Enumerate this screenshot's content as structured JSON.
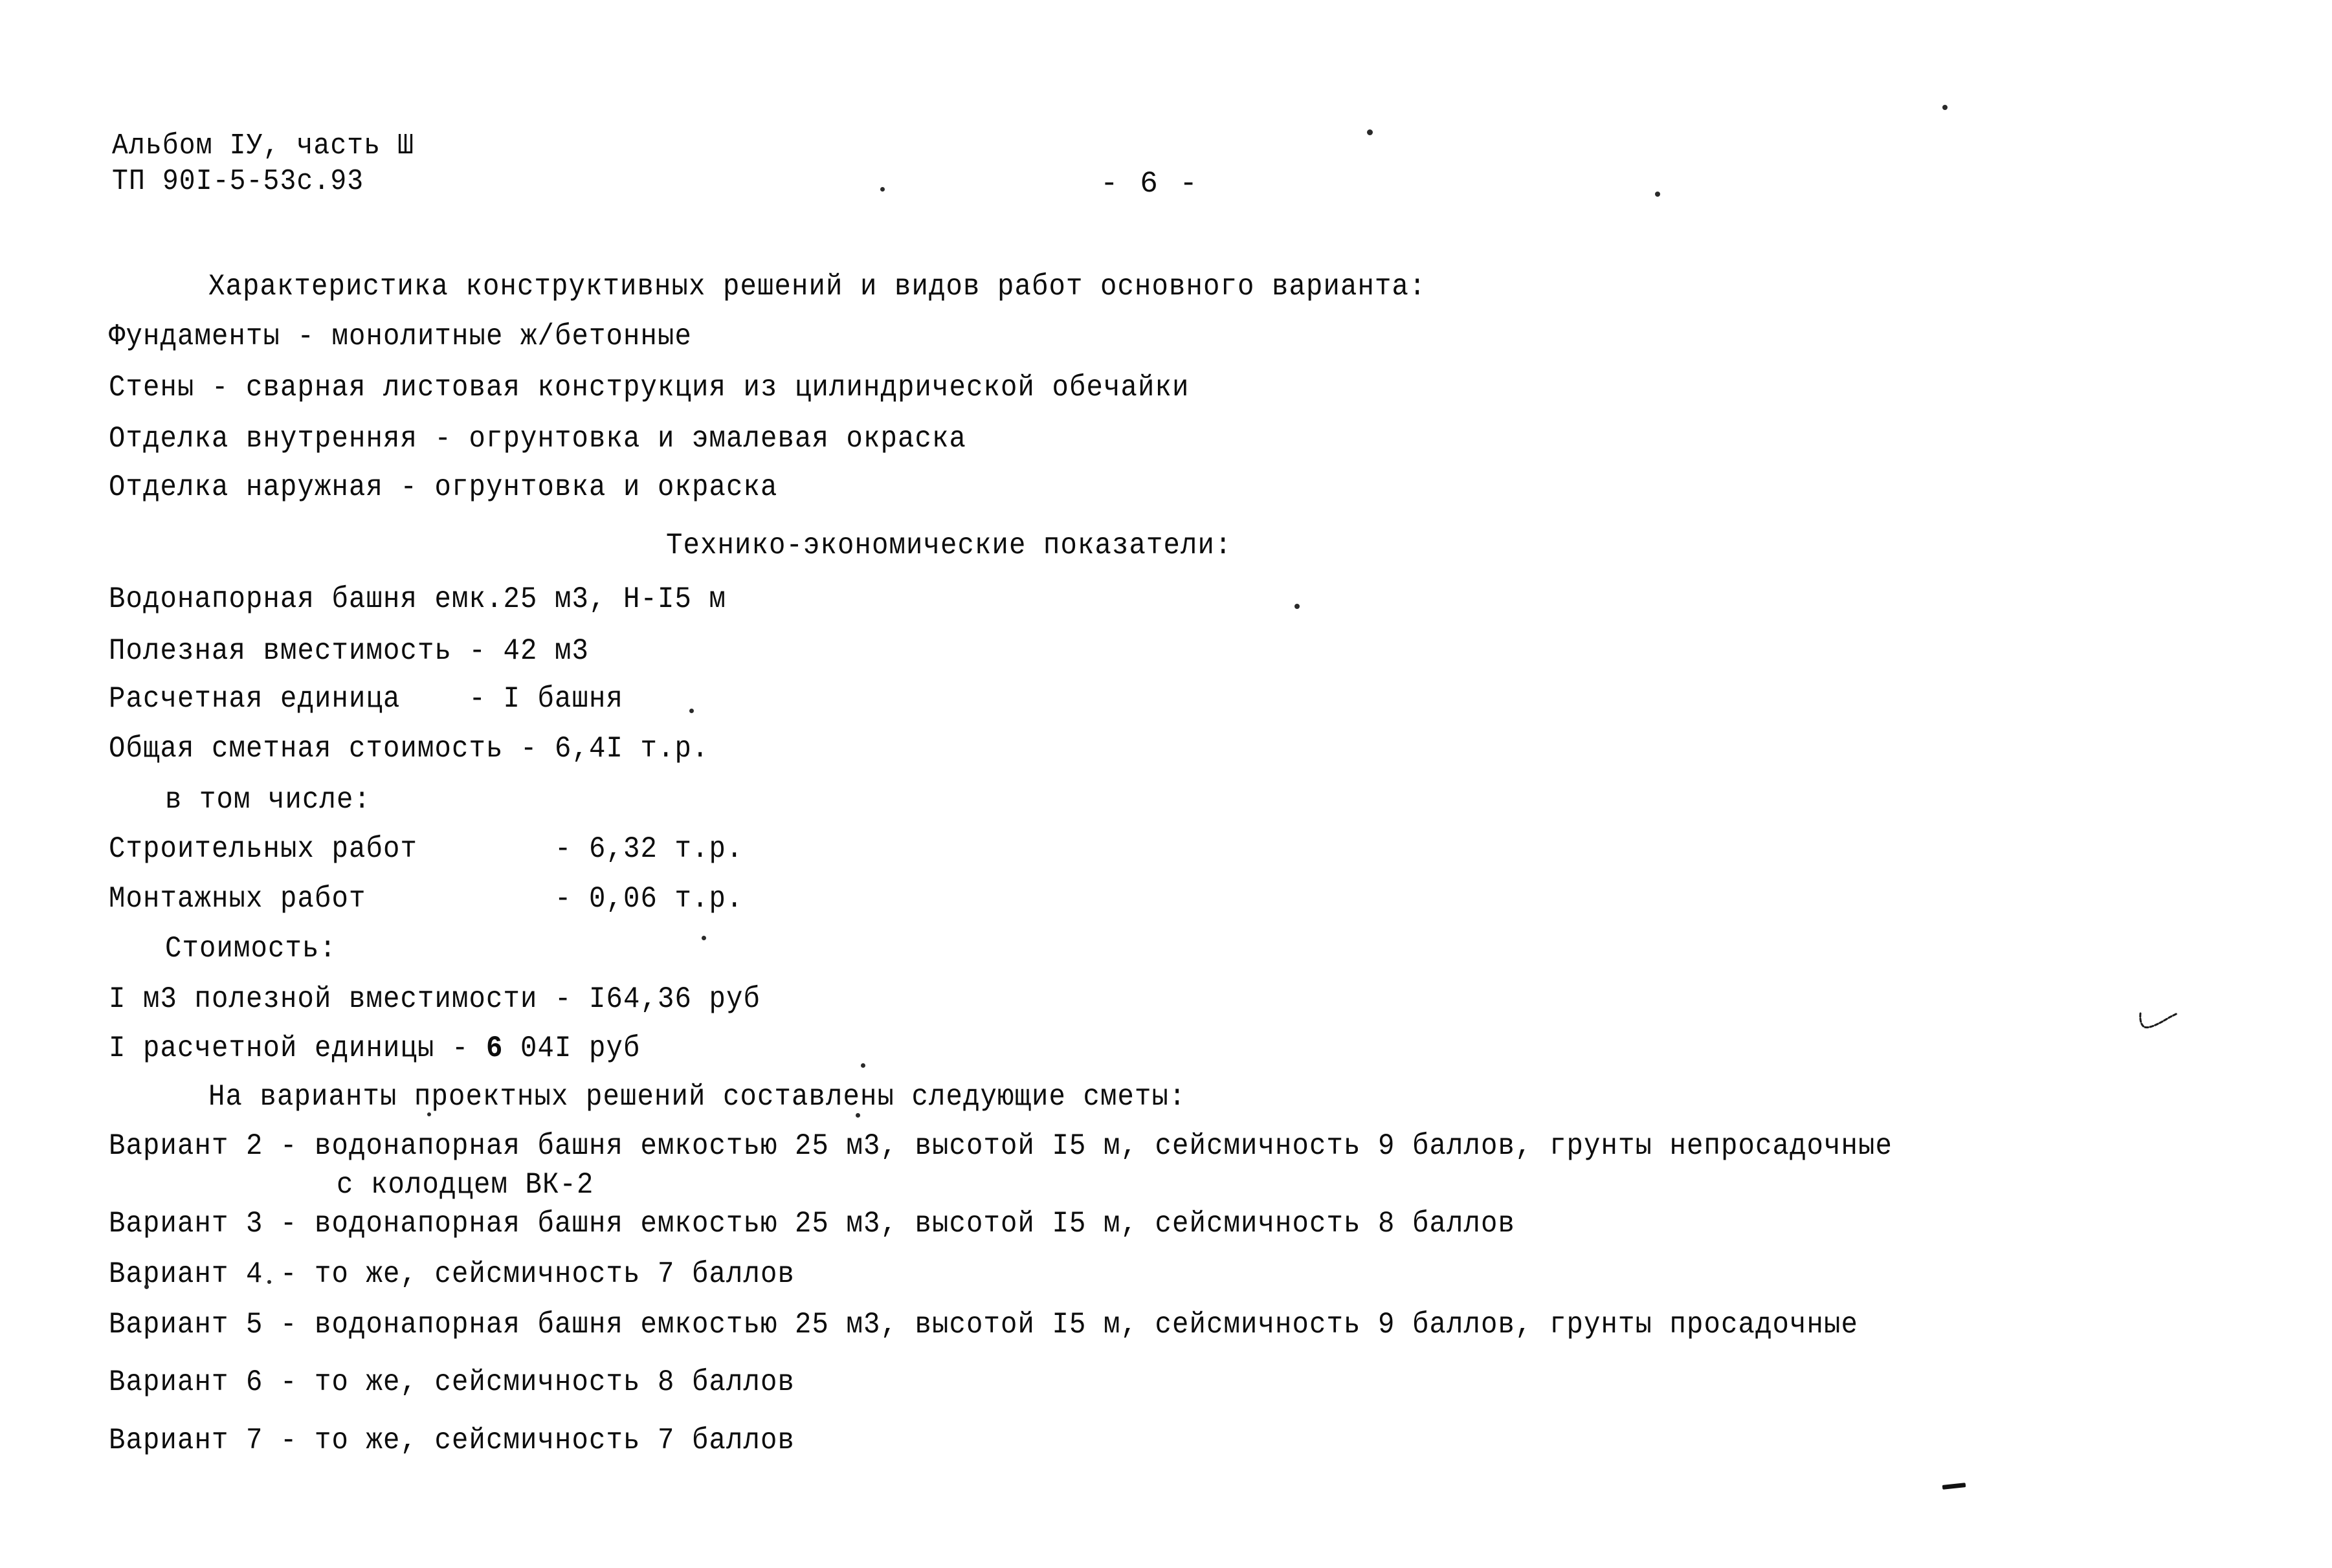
{
  "document": {
    "album_line": "Альбом IУ, часть Ш",
    "code_line": "ТП 90I-5-53с.93",
    "page_number": "- 6 -"
  },
  "sections": {
    "characteristics_heading": "Характеристика конструктивных решений и видов работ основного варианта:",
    "characteristics": [
      "Фундаменты - монолитные ж/бетонные",
      "Стены - сварная листовая конструкция из цилиндрической обечайки",
      "Отделка внутренняя - огрунтовка и эмалевая окраска",
      "Отделка наружная - огрунтовка и окраска"
    ],
    "indicators_heading": "Технико-экономические показатели:",
    "indicators": [
      "Водонапорная башня емк.25 м3, Н-I5 м",
      "Полезная вместимость - 42 м3",
      "Расчетная единица    - I башня",
      "Общая сметная стоимость - 6,4I т.р."
    ],
    "including_label": "в том числе:",
    "including": [
      "Строительных работ        - 6,32 т.р.",
      "Монтажных работ           - 0,06 т.р."
    ],
    "cost_label": "Стоимость:",
    "cost_items_prefix": [
      "I м3 полезной вместимости - I64,36 руб"
    ],
    "unit_cost": {
      "prefix": "I расчетной единицы - ",
      "bold_part": "6",
      "suffix": " 04I руб"
    },
    "variants_heading": "На варианты проектных решений составлены следующие сметы:",
    "variants": [
      {
        "line1": "Вариант 2 - водонапорная башня емкостью 25 м3, высотой I5 м, сейсмичность 9 баллов, грунты непросадочные",
        "line2": "с колодцем ВК-2"
      },
      {
        "line1": "Вариант 3 - водонапорная башня емкостью 25 м3, высотой I5 м, сейсмичность 8 баллов",
        "line2": ""
      },
      {
        "line1": "Вариант 4 - то же, сейсмичность 7 баллов",
        "line2": ""
      },
      {
        "line1": "Вариант 5 - водонапорная башня емкостью 25 м3, высотой I5 м, сейсмичность 9 баллов, грунты просадочные",
        "line2": ""
      },
      {
        "line1": "Вариант 6 - то же, сейсмичность 8 баллов",
        "line2": ""
      },
      {
        "line1": "Вариант 7 - то же, сейсмичность 7 баллов",
        "line2": ""
      }
    ]
  }
}
